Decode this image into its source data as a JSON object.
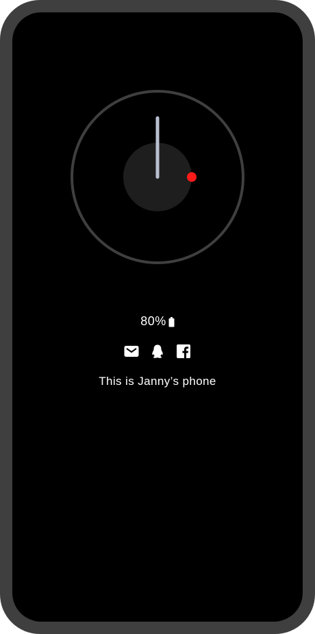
{
  "lockscreen": {
    "battery_text": "80%",
    "owner_text": "This is Janny’s phone",
    "notifications": [
      {
        "icon": "mail-icon"
      },
      {
        "icon": "qq-penguin-icon"
      },
      {
        "icon": "facebook-icon"
      }
    ]
  },
  "colors": {
    "frame": "#3f3f3f",
    "screen": "#000000",
    "clock_ring": "#3f3f3f",
    "clock_center": "#1e1e1e",
    "hand": "#b8c0d0",
    "second_dot": "#ff1a1a",
    "text": "#ffffff"
  }
}
